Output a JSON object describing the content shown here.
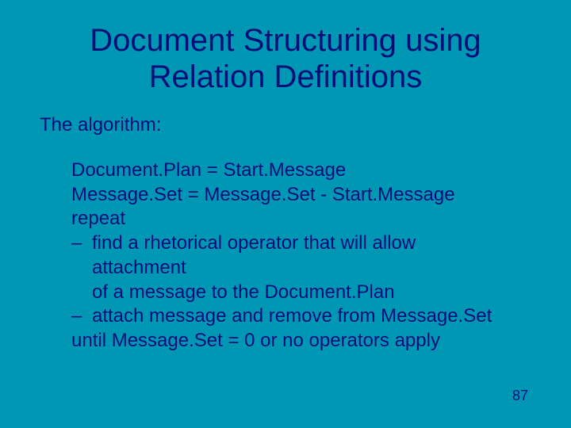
{
  "title_line1": "Document Structuring using",
  "title_line2": "Relation Definitions",
  "subhead": "The algorithm:",
  "body": {
    "l1": "Document.Plan = Start.Message",
    "l2": "Message.Set = Message.Set - Start.Message",
    "l3": "repeat",
    "l4a": "find a rhetorical operator that will allow attachment",
    "l4b": "of a message to the Document.Plan",
    "l5": "attach message and remove from Message.Set",
    "l6": "until Message.Set = 0 or no operators apply"
  },
  "dash": "–",
  "slide_number": "87"
}
